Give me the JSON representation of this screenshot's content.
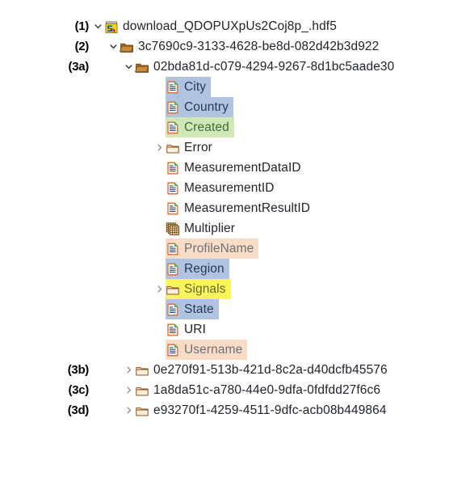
{
  "viewer": {
    "title": "HDF5 file tree",
    "colors": {
      "select_blue": "#b0c4e2",
      "select_green": "#cfe8b6",
      "select_yellow": "#faf55e",
      "select_peach": "#f8dcc6",
      "folder_dark": "#b07828",
      "folder_light": "#f5cfa6",
      "dataset_border": "#e0672a",
      "hdf5_yellow": "#ffd800",
      "hdf5_blue": "#2a4fa0",
      "twisty_gray": "#8a8a8a"
    }
  },
  "tree": [
    {
      "callout": "(1)",
      "depth": 0,
      "twisty": "expanded",
      "icon": "hdf5-file-icon",
      "label": "download_QDOPUXpUs2Coj8p_.hdf5",
      "highlight": "none",
      "label_style": "normal"
    },
    {
      "callout": "(2)",
      "depth": 1,
      "twisty": "expanded",
      "icon": "folder-open-dark-icon",
      "label": "3c7690c9-3133-4628-be8d-082d42b3d922",
      "highlight": "none",
      "label_style": "normal"
    },
    {
      "callout": "(3a)",
      "depth": 2,
      "twisty": "expanded",
      "icon": "folder-open-dark-icon",
      "label": "02bda81d-c079-4294-9267-8d1bc5aade30",
      "highlight": "none",
      "label_style": "normal"
    },
    {
      "callout": "",
      "depth": 4,
      "twisty": "none",
      "icon": "dataset-icon",
      "label": "City",
      "highlight": "blue",
      "label_style": "blue"
    },
    {
      "callout": "",
      "depth": 4,
      "twisty": "none",
      "icon": "dataset-icon",
      "label": "Country",
      "highlight": "blue",
      "label_style": "blue"
    },
    {
      "callout": "",
      "depth": 4,
      "twisty": "none",
      "icon": "dataset-icon",
      "label": "Created",
      "highlight": "green",
      "label_style": "green"
    },
    {
      "callout": "",
      "depth": 4,
      "twisty": "collapsed",
      "icon": "folder-closed-light-icon",
      "label": "Error",
      "highlight": "none",
      "label_style": "normal"
    },
    {
      "callout": "",
      "depth": 4,
      "twisty": "none",
      "icon": "dataset-icon",
      "label": "MeasurementDataID",
      "highlight": "none",
      "label_style": "normal"
    },
    {
      "callout": "",
      "depth": 4,
      "twisty": "none",
      "icon": "dataset-icon",
      "label": "MeasurementID",
      "highlight": "none",
      "label_style": "normal"
    },
    {
      "callout": "",
      "depth": 4,
      "twisty": "none",
      "icon": "dataset-icon",
      "label": "MeasurementResultID",
      "highlight": "none",
      "label_style": "normal"
    },
    {
      "callout": "",
      "depth": 4,
      "twisty": "none",
      "icon": "table-grid-icon",
      "label": "Multiplier",
      "highlight": "none",
      "label_style": "normal"
    },
    {
      "callout": "",
      "depth": 4,
      "twisty": "none",
      "icon": "dataset-icon",
      "label": "ProfileName",
      "highlight": "peach",
      "label_style": "dim"
    },
    {
      "callout": "",
      "depth": 4,
      "twisty": "none",
      "icon": "dataset-icon",
      "label": "Region",
      "highlight": "blue",
      "label_style": "blue"
    },
    {
      "callout": "",
      "depth": 4,
      "twisty": "collapsed",
      "icon": "folder-closed-light-icon",
      "label": "Signals",
      "highlight": "yellow",
      "label_style": "olive"
    },
    {
      "callout": "",
      "depth": 4,
      "twisty": "none",
      "icon": "dataset-icon",
      "label": "State",
      "highlight": "blue",
      "label_style": "blue"
    },
    {
      "callout": "",
      "depth": 4,
      "twisty": "none",
      "icon": "dataset-icon",
      "label": "URI",
      "highlight": "none",
      "label_style": "normal"
    },
    {
      "callout": "",
      "depth": 4,
      "twisty": "none",
      "icon": "dataset-icon",
      "label": "Username",
      "highlight": "peach",
      "label_style": "dim"
    },
    {
      "callout": "(3b)",
      "depth": 2,
      "twisty": "collapsed",
      "icon": "folder-closed-light-icon",
      "label": "0e270f91-513b-421d-8c2a-d40dcfb45576",
      "highlight": "none",
      "label_style": "normal"
    },
    {
      "callout": "(3c)",
      "depth": 2,
      "twisty": "collapsed",
      "icon": "folder-closed-light-icon",
      "label": "1a8da51c-a780-44e0-9dfa-0fdfdd27f6c6",
      "highlight": "none",
      "label_style": "normal"
    },
    {
      "callout": "(3d)",
      "depth": 2,
      "twisty": "collapsed",
      "icon": "folder-closed-light-icon",
      "label": "e93270f1-4259-4511-9dfc-acb08b449864",
      "highlight": "none",
      "label_style": "normal"
    }
  ]
}
